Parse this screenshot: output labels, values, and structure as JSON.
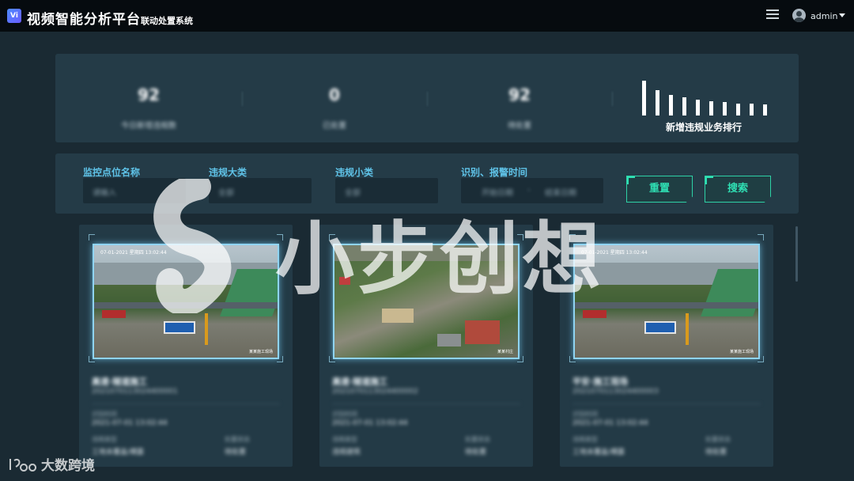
{
  "header": {
    "logo_text": "Vi",
    "title": "视频智能分析平台",
    "subtitle": "联动处置系统",
    "username": "admin"
  },
  "stats": {
    "items": [
      {
        "value": "92",
        "label": "今日新增违规数"
      },
      {
        "value": "0",
        "label": "已处置"
      },
      {
        "value": "92",
        "label": "待处置"
      }
    ],
    "rank_label": "新增违规业务排行",
    "rank_bars": [
      1.0,
      0.72,
      0.6,
      0.52,
      0.46,
      0.42,
      0.38,
      0.35,
      0.33,
      0.31
    ]
  },
  "filters": {
    "monitor_label": "监控点位名称",
    "monitor_placeholder": "请输入",
    "major_label": "违规大类",
    "major_value": "全部",
    "minor_label": "违规小类",
    "minor_value": "全部",
    "time_label": "识别、报警时间",
    "time_start": "开始日期",
    "time_sep": "-",
    "time_end": "结束日期",
    "reset_label": "重置",
    "search_label": "搜索"
  },
  "cards": [
    {
      "timestamp": "07-01-2021 星期四 13:02:44",
      "camera_label": "某某施工现场",
      "title": "高速·隧道施工",
      "subtitle": "2021070113024400001",
      "k1": "识别时间",
      "v1": "2021-07-01 13:02:44",
      "k2": "违规类型",
      "v2": "工地未覆盖/裸露",
      "k3": "处置状态",
      "v3": "待处置"
    },
    {
      "timestamp": "",
      "camera_label": "某某村庄",
      "title": "高速·隧道施工",
      "subtitle": "2021070113024400002",
      "k1": "识别时间",
      "v1": "2021-07-01 13:02:44",
      "k2": "违规类型",
      "v2": "违规建筑",
      "k3": "处置状态",
      "v3": "待处置"
    },
    {
      "timestamp": "07-01-2021 星期四 13:02:44",
      "camera_label": "某某施工现场",
      "title": "平安·施工现场",
      "subtitle": "2021070113024400003",
      "k1": "识别时间",
      "v1": "2021-07-01 13:02:44",
      "k2": "违规类型",
      "v2": "工地未覆盖/裸露",
      "k3": "处置状态",
      "v3": "待处置"
    }
  ],
  "watermark": {
    "text": "小步创想",
    "footer": "大数跨境"
  },
  "colors": {
    "topbar": "#060b0f",
    "background": "#1a2a33",
    "panel": "#243b47",
    "label_blue": "#5fc3e8",
    "button_teal": "#2fe0b4",
    "frame_glow": "#8fd4f2"
  }
}
